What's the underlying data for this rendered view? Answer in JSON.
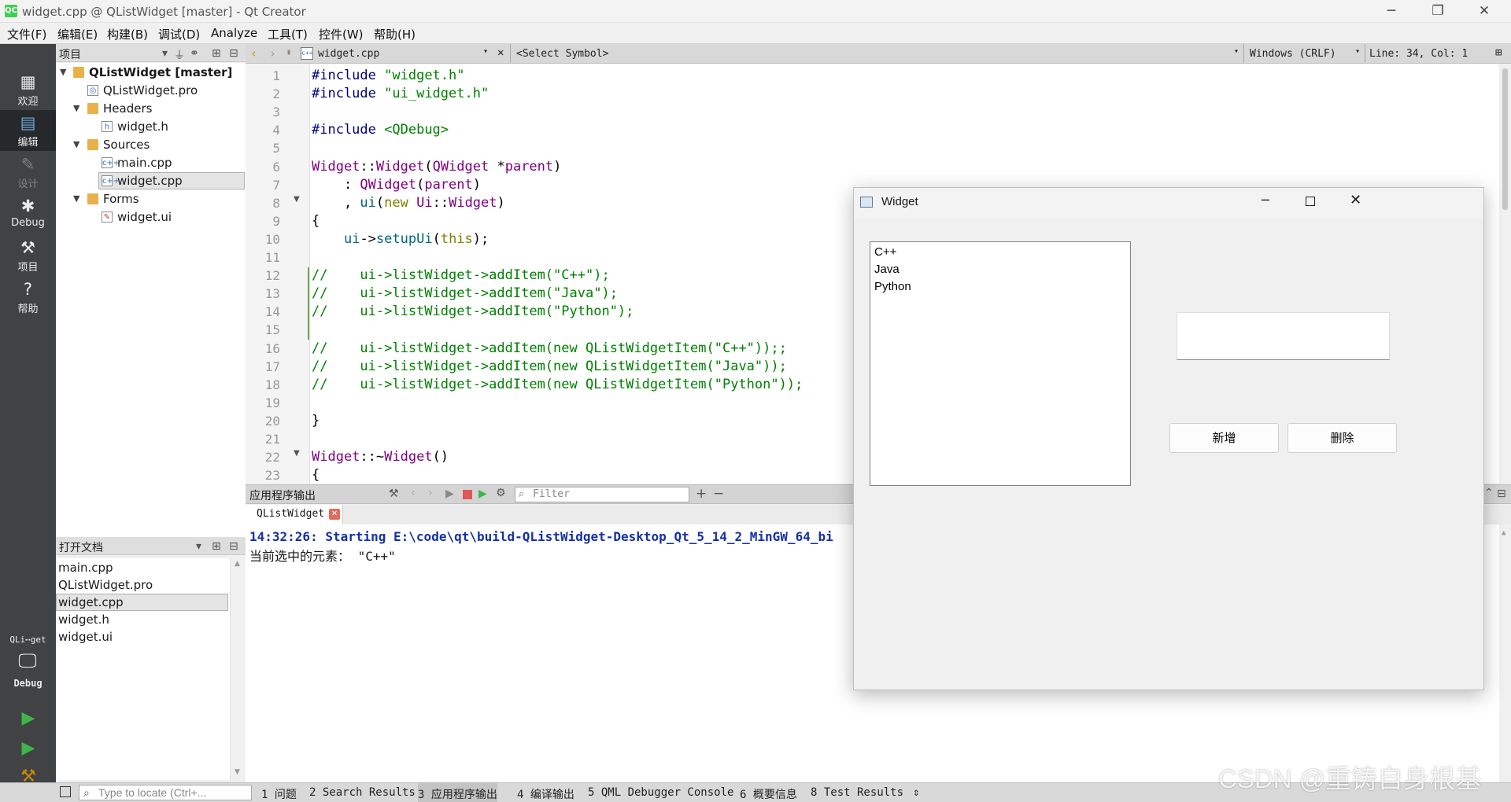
{
  "window": {
    "title": "widget.cpp @ QListWidget [master] - Qt Creator",
    "app_icon": "QC"
  },
  "menu": [
    "文件(F)",
    "编辑(E)",
    "构建(B)",
    "调试(D)",
    "Analyze",
    "工具(T)",
    "控件(W)",
    "帮助(H)"
  ],
  "modes": [
    {
      "label": "欢迎",
      "icon": "grid-icon"
    },
    {
      "label": "编辑",
      "icon": "edit-icon"
    },
    {
      "label": "设计",
      "icon": "pencil-icon"
    },
    {
      "label": "Debug",
      "icon": "bug-icon"
    },
    {
      "label": "项目",
      "icon": "wrench-icon"
    },
    {
      "label": "帮助",
      "icon": "help-icon"
    }
  ],
  "target": {
    "project": "QLi⋯get",
    "config": "Debug"
  },
  "projects_panel": {
    "title": "项目",
    "tree": [
      {
        "label": "QListWidget [master]",
        "level": 0,
        "type": "project",
        "expanded": true
      },
      {
        "label": "QListWidget.pro",
        "level": 1,
        "type": "file"
      },
      {
        "label": "Headers",
        "level": 1,
        "type": "folder",
        "expanded": true
      },
      {
        "label": "widget.h",
        "level": 2,
        "type": "file"
      },
      {
        "label": "Sources",
        "level": 1,
        "type": "folder",
        "expanded": true
      },
      {
        "label": "main.cpp",
        "level": 2,
        "type": "file"
      },
      {
        "label": "widget.cpp",
        "level": 2,
        "type": "file",
        "selected": true
      },
      {
        "label": "Forms",
        "level": 1,
        "type": "folder",
        "expanded": true
      },
      {
        "label": "widget.ui",
        "level": 2,
        "type": "file"
      }
    ]
  },
  "open_docs": {
    "title": "打开文档",
    "items": [
      "main.cpp",
      "QListWidget.pro",
      "widget.cpp",
      "widget.h",
      "widget.ui"
    ],
    "selected": "widget.cpp"
  },
  "editor": {
    "file": "widget.cpp",
    "symbol": "<Select Symbol>",
    "line_ending": "Windows (CRLF)",
    "position": "Line: 34, Col: 1",
    "lines": [
      {
        "n": "1",
        "t": "#include \"widget.h\""
      },
      {
        "n": "2",
        "t": "#include \"ui_widget.h\""
      },
      {
        "n": "3",
        "t": ""
      },
      {
        "n": "4",
        "t": "#include <QDebug>"
      },
      {
        "n": "5",
        "t": ""
      },
      {
        "n": "6",
        "t": "Widget::Widget(QWidget *parent)"
      },
      {
        "n": "7",
        "t": "    : QWidget(parent)"
      },
      {
        "n": "8",
        "t": "    , ui(new Ui::Widget)"
      },
      {
        "n": "9",
        "t": "{"
      },
      {
        "n": "10",
        "t": "    ui->setupUi(this);"
      },
      {
        "n": "11",
        "t": ""
      },
      {
        "n": "12",
        "t": "//    ui->listWidget->addItem(\"C++\");"
      },
      {
        "n": "13",
        "t": "//    ui->listWidget->addItem(\"Java\");"
      },
      {
        "n": "14",
        "t": "//    ui->listWidget->addItem(\"Python\");"
      },
      {
        "n": "15",
        "t": ""
      },
      {
        "n": "16",
        "t": "//    ui->listWidget->addItem(new QListWidgetItem(\"C++\"));;"
      },
      {
        "n": "17",
        "t": "//    ui->listWidget->addItem(new QListWidgetItem(\"Java\"));"
      },
      {
        "n": "18",
        "t": "//    ui->listWidget->addItem(new QListWidgetItem(\"Python\"));"
      },
      {
        "n": "19",
        "t": ""
      },
      {
        "n": "20",
        "t": "}"
      },
      {
        "n": "21",
        "t": ""
      },
      {
        "n": "22",
        "t": "Widget::~Widget()"
      },
      {
        "n": "23",
        "t": "{"
      }
    ]
  },
  "output": {
    "title": "应用程序输出",
    "filter_placeholder": "Filter",
    "tab": "QListWidget",
    "line1": "14:32:26: Starting E:\\code\\qt\\build-QListWidget-Desktop_Qt_5_14_2_MinGW_64_bi",
    "line2": "当前选中的元素： \"C++\""
  },
  "statusbar": {
    "locator_placeholder": "Type to locate (Ctrl+...",
    "tabs": [
      "1 问题",
      "2 Search Results",
      "3 应用程序输出",
      "4 编译输出",
      "5 QML Debugger Console",
      "6 概要信息",
      "8 Test Results"
    ]
  },
  "widget_window": {
    "title": "Widget",
    "list_items": [
      "C++",
      "Java",
      "Python"
    ],
    "input_value": "",
    "add_button": "新增",
    "delete_button": "删除"
  },
  "watermark": "CSDN @重铸自身根基"
}
